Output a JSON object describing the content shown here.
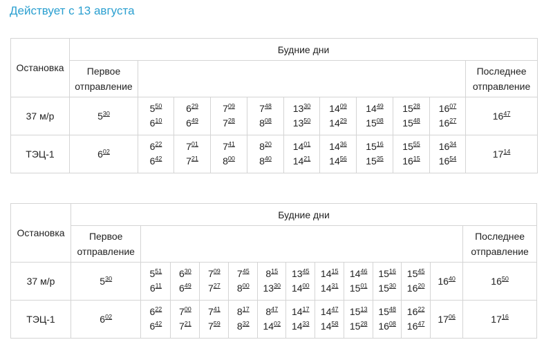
{
  "notice": "Действует с 13 августа",
  "tables": [
    {
      "header": {
        "stop": "Остановка",
        "days": "Будние дни",
        "first": "Первое отправление",
        "last": "Последнее отправление"
      },
      "rows": [
        {
          "stop": "37 м/р",
          "first": [
            "5",
            "30"
          ],
          "last": [
            "16",
            "47"
          ],
          "cells": [
            [
              [
                "5",
                "50"
              ],
              [
                "6",
                "10"
              ]
            ],
            [
              [
                "6",
                "29"
              ],
              [
                "6",
                "49"
              ]
            ],
            [
              [
                "7",
                "09"
              ],
              [
                "7",
                "28"
              ]
            ],
            [
              [
                "7",
                "48"
              ],
              [
                "8",
                "08"
              ]
            ],
            [
              [
                "13",
                "30"
              ],
              [
                "13",
                "50"
              ]
            ],
            [
              [
                "14",
                "09"
              ],
              [
                "14",
                "29"
              ]
            ],
            [
              [
                "14",
                "49"
              ],
              [
                "15",
                "08"
              ]
            ],
            [
              [
                "15",
                "28"
              ],
              [
                "15",
                "48"
              ]
            ],
            [
              [
                "16",
                "07"
              ],
              [
                "16",
                "27"
              ]
            ]
          ]
        },
        {
          "stop": "ТЭЦ-1",
          "first": [
            "6",
            "02"
          ],
          "last": [
            "17",
            "14"
          ],
          "cells": [
            [
              [
                "6",
                "22"
              ],
              [
                "6",
                "42"
              ]
            ],
            [
              [
                "7",
                "01"
              ],
              [
                "7",
                "21"
              ]
            ],
            [
              [
                "7",
                "41"
              ],
              [
                "8",
                "00"
              ]
            ],
            [
              [
                "8",
                "20"
              ],
              [
                "8",
                "40"
              ]
            ],
            [
              [
                "14",
                "01"
              ],
              [
                "14",
                "21"
              ]
            ],
            [
              [
                "14",
                "36"
              ],
              [
                "14",
                "56"
              ]
            ],
            [
              [
                "15",
                "16"
              ],
              [
                "15",
                "35"
              ]
            ],
            [
              [
                "15",
                "55"
              ],
              [
                "16",
                "15"
              ]
            ],
            [
              [
                "16",
                "34"
              ],
              [
                "16",
                "54"
              ]
            ]
          ]
        }
      ]
    },
    {
      "header": {
        "stop": "Остановка",
        "days": "Будние дни",
        "first": "Первое отправление",
        "last": "Последнее отправление"
      },
      "rows": [
        {
          "stop": "37 м/р",
          "first": [
            "5",
            "30"
          ],
          "last": [
            "16",
            "50"
          ],
          "cells": [
            [
              [
                "5",
                "51"
              ],
              [
                "6",
                "11"
              ]
            ],
            [
              [
                "6",
                "30"
              ],
              [
                "6",
                "49"
              ]
            ],
            [
              [
                "7",
                "09"
              ],
              [
                "7",
                "27"
              ]
            ],
            [
              [
                "7",
                "45"
              ],
              [
                "8",
                "00"
              ]
            ],
            [
              [
                "8",
                "15"
              ],
              [
                "13",
                "30"
              ]
            ],
            [
              [
                "13",
                "45"
              ],
              [
                "14",
                "00"
              ]
            ],
            [
              [
                "14",
                "15"
              ],
              [
                "14",
                "31"
              ]
            ],
            [
              [
                "14",
                "46"
              ],
              [
                "15",
                "01"
              ]
            ],
            [
              [
                "15",
                "16"
              ],
              [
                "15",
                "30"
              ]
            ],
            [
              [
                "15",
                "45"
              ],
              [
                "16",
                "20"
              ]
            ],
            [
              [
                "16",
                "40"
              ]
            ]
          ]
        },
        {
          "stop": "ТЭЦ-1",
          "first": [
            "6",
            "02"
          ],
          "last": [
            "17",
            "16"
          ],
          "cells": [
            [
              [
                "6",
                "22"
              ],
              [
                "6",
                "42"
              ]
            ],
            [
              [
                "7",
                "00"
              ],
              [
                "7",
                "21"
              ]
            ],
            [
              [
                "7",
                "41"
              ],
              [
                "7",
                "59"
              ]
            ],
            [
              [
                "8",
                "17"
              ],
              [
                "8",
                "32"
              ]
            ],
            [
              [
                "8",
                "47"
              ],
              [
                "14",
                "02"
              ]
            ],
            [
              [
                "14",
                "17"
              ],
              [
                "14",
                "33"
              ]
            ],
            [
              [
                "14",
                "47"
              ],
              [
                "14",
                "58"
              ]
            ],
            [
              [
                "15",
                "13"
              ],
              [
                "15",
                "28"
              ]
            ],
            [
              [
                "15",
                "48"
              ],
              [
                "16",
                "08"
              ]
            ],
            [
              [
                "16",
                "22"
              ],
              [
                "16",
                "47"
              ]
            ],
            [
              [
                "17",
                "06"
              ]
            ]
          ]
        }
      ]
    }
  ]
}
